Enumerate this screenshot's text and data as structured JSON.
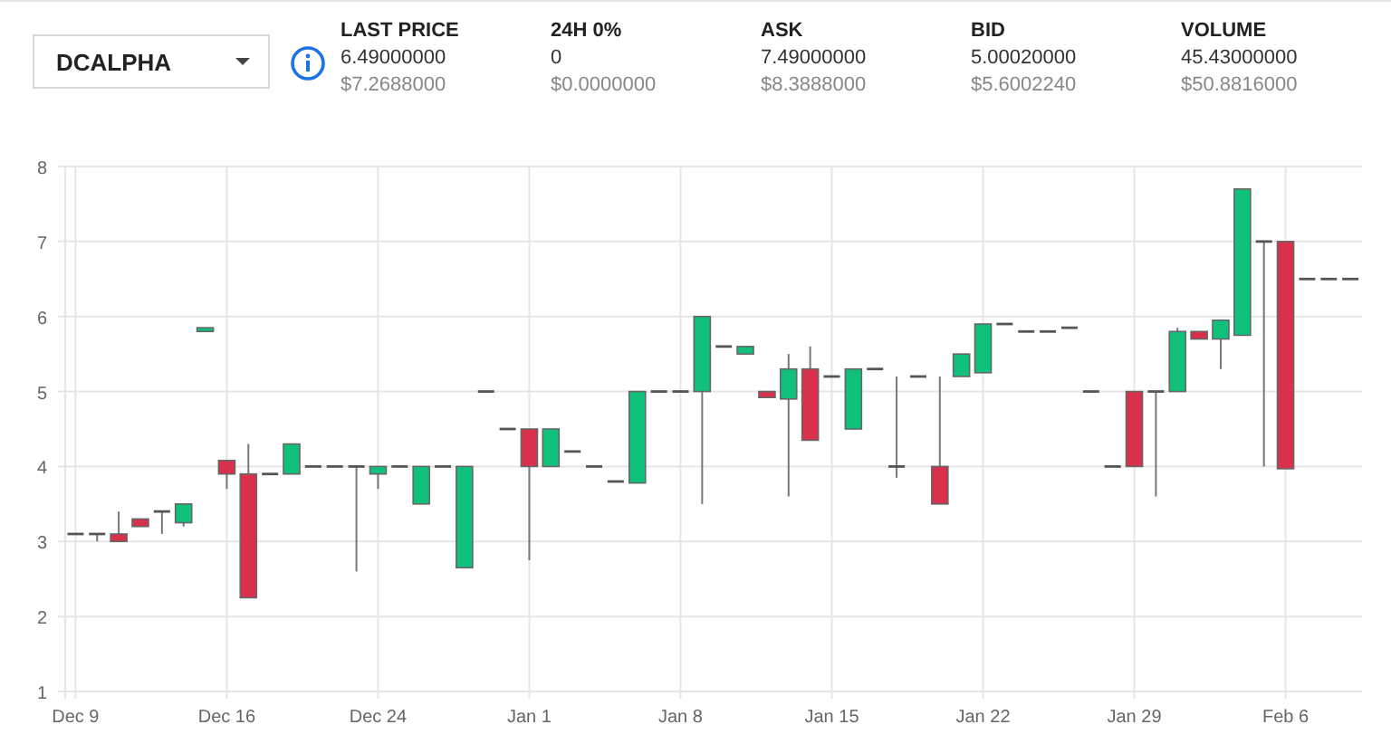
{
  "market_select": {
    "value": "DCALPHA"
  },
  "stats": [
    {
      "label": "LAST PRICE",
      "value": "6.49000000",
      "usd": "$7.2688000"
    },
    {
      "label": "24H 0%",
      "value": "0",
      "usd": "$0.0000000"
    },
    {
      "label": "ASK",
      "value": "7.49000000",
      "usd": "$8.3888000"
    },
    {
      "label": "BID",
      "value": "5.00020000",
      "usd": "$5.6002240"
    },
    {
      "label": "VOLUME",
      "value": "45.43000000",
      "usd": "$50.8816000"
    }
  ],
  "chart": {
    "chart_data": {
      "type": "candlestick",
      "grid": true,
      "ylim": [
        1,
        8
      ],
      "yticks": [
        1,
        2,
        3,
        4,
        5,
        6,
        7,
        8
      ],
      "categories": [
        "Dec 9",
        null,
        null,
        null,
        null,
        null,
        null,
        "Dec 16",
        null,
        null,
        null,
        null,
        null,
        null,
        "Dec 24",
        null,
        null,
        null,
        null,
        null,
        null,
        "Jan 1",
        null,
        null,
        null,
        null,
        null,
        null,
        "Jan 8",
        null,
        null,
        null,
        null,
        null,
        null,
        "Jan 15",
        null,
        null,
        null,
        null,
        null,
        null,
        "Jan 22",
        null,
        null,
        null,
        null,
        null,
        null,
        "Jan 29",
        null,
        null,
        null,
        null,
        null,
        null,
        "Feb 6",
        null,
        null,
        null
      ],
      "ohlc": [
        [
          3.1,
          3.1,
          3.1,
          3.1
        ],
        [
          3.1,
          3.1,
          3.0,
          3.1
        ],
        [
          3.1,
          3.4,
          3.0,
          3.0
        ],
        [
          3.3,
          3.3,
          3.2,
          3.2
        ],
        [
          3.4,
          3.4,
          3.1,
          3.4
        ],
        [
          3.25,
          3.5,
          3.2,
          3.5
        ],
        [
          5.8,
          5.85,
          5.8,
          5.85
        ],
        [
          4.08,
          4.08,
          3.7,
          3.9
        ],
        [
          3.9,
          4.3,
          2.25,
          2.25
        ],
        [
          3.9,
          3.9,
          3.9,
          3.9
        ],
        [
          3.9,
          4.3,
          3.9,
          4.3
        ],
        [
          4,
          4,
          4,
          4
        ],
        [
          4,
          4,
          4,
          4
        ],
        [
          4,
          4,
          2.6,
          4
        ],
        [
          3.9,
          4,
          3.7,
          4
        ],
        [
          4,
          4,
          4,
          4
        ],
        [
          3.5,
          4,
          3.5,
          4
        ],
        [
          4,
          4,
          4,
          4
        ],
        [
          2.65,
          4,
          2.65,
          4
        ],
        [
          5,
          5,
          5,
          5
        ],
        [
          4.5,
          4.5,
          4.5,
          4.5
        ],
        [
          4.5,
          4.5,
          2.75,
          4
        ],
        [
          4,
          4.5,
          4,
          4.5
        ],
        [
          4.2,
          4.2,
          4.2,
          4.2
        ],
        [
          4,
          4,
          4,
          4
        ],
        [
          3.8,
          3.8,
          3.8,
          3.8
        ],
        [
          3.78,
          5,
          3.78,
          5
        ],
        [
          5,
          5,
          5,
          5
        ],
        [
          5,
          5,
          5,
          5
        ],
        [
          5,
          6,
          3.5,
          6
        ],
        [
          5.6,
          5.6,
          5.6,
          5.6
        ],
        [
          5.5,
          5.6,
          5.5,
          5.6
        ],
        [
          5,
          5,
          4.92,
          4.92
        ],
        [
          4.9,
          5.5,
          3.6,
          5.3
        ],
        [
          5.3,
          5.6,
          4.35,
          4.35
        ],
        [
          5.2,
          5.2,
          5.2,
          5.2
        ],
        [
          4.5,
          5.3,
          4.5,
          5.3
        ],
        [
          5.3,
          5.3,
          5.3,
          5.3
        ],
        [
          4,
          5.2,
          3.85,
          4
        ],
        [
          5.2,
          5.2,
          5.2,
          5.2
        ],
        [
          4,
          5.2,
          3.5,
          3.5
        ],
        [
          5.2,
          5.5,
          5.2,
          5.5
        ],
        [
          5.25,
          5.9,
          5.25,
          5.9
        ],
        [
          5.9,
          5.9,
          5.9,
          5.9
        ],
        [
          5.8,
          5.8,
          5.8,
          5.8
        ],
        [
          5.8,
          5.8,
          5.8,
          5.8
        ],
        [
          5.85,
          5.85,
          5.85,
          5.85
        ],
        [
          5,
          5,
          5,
          5
        ],
        [
          4,
          4,
          4,
          4
        ],
        [
          5,
          5,
          4,
          4
        ],
        [
          5,
          5,
          3.6,
          5
        ],
        [
          5,
          5.85,
          5,
          5.8
        ],
        [
          5.8,
          5.8,
          5.7,
          5.7
        ],
        [
          5.7,
          5.95,
          5.3,
          5.95
        ],
        [
          5.75,
          7.7,
          5.75,
          7.7
        ],
        [
          7,
          7,
          4,
          7
        ],
        [
          7,
          7,
          3.97,
          3.97
        ],
        [
          6.5,
          6.5,
          6.5,
          6.5
        ],
        [
          6.5,
          6.5,
          6.5,
          6.5
        ],
        [
          6.5,
          6.5,
          6.5,
          6.5
        ]
      ]
    }
  }
}
